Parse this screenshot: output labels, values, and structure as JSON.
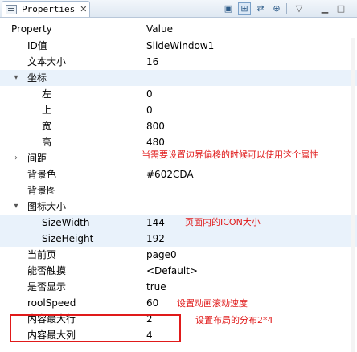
{
  "tab": {
    "label": "Properties",
    "close": "✕"
  },
  "toolbar": {
    "buttons": [
      "new-icon",
      "tree-view-icon",
      "filter-icon",
      "expand-icon",
      "menu-icon"
    ]
  },
  "columns": {
    "property": "Property",
    "value": "Value"
  },
  "rows": [
    {
      "name": "ID值",
      "value": "SlideWindow1"
    },
    {
      "name": "文本大小",
      "value": "16"
    },
    {
      "name": "坐标",
      "value": ""
    },
    {
      "name": "左",
      "value": "0"
    },
    {
      "name": "上",
      "value": "0"
    },
    {
      "name": "宽",
      "value": "800"
    },
    {
      "name": "高",
      "value": "480"
    },
    {
      "name": "间距",
      "value": ""
    },
    {
      "name": "背景色",
      "value": "#602CDA"
    },
    {
      "name": "背景图",
      "value": ""
    },
    {
      "name": "图标大小",
      "value": ""
    },
    {
      "name": "SizeWidth",
      "value": "144"
    },
    {
      "name": "SizeHeight",
      "value": "192"
    },
    {
      "name": "当前页",
      "value": "page0"
    },
    {
      "name": "能否触摸",
      "value": "<Default>"
    },
    {
      "name": "是否显示",
      "value": "true"
    },
    {
      "name": "roolSpeed",
      "value": "60"
    },
    {
      "name": "内容最大行",
      "value": "2"
    },
    {
      "name": "内容最大列",
      "value": "4"
    }
  ],
  "annotations": {
    "margin_note": "当需要设置边界偏移的时候可以使用这个属性",
    "icon_note": "页面内的ICON大小",
    "speed_note": "设置动画滚动速度",
    "layout_note": "设置布局的分布2*4"
  },
  "colors": {
    "annotation": "#e01a1a",
    "row_highlight": "#e9f2fb"
  }
}
